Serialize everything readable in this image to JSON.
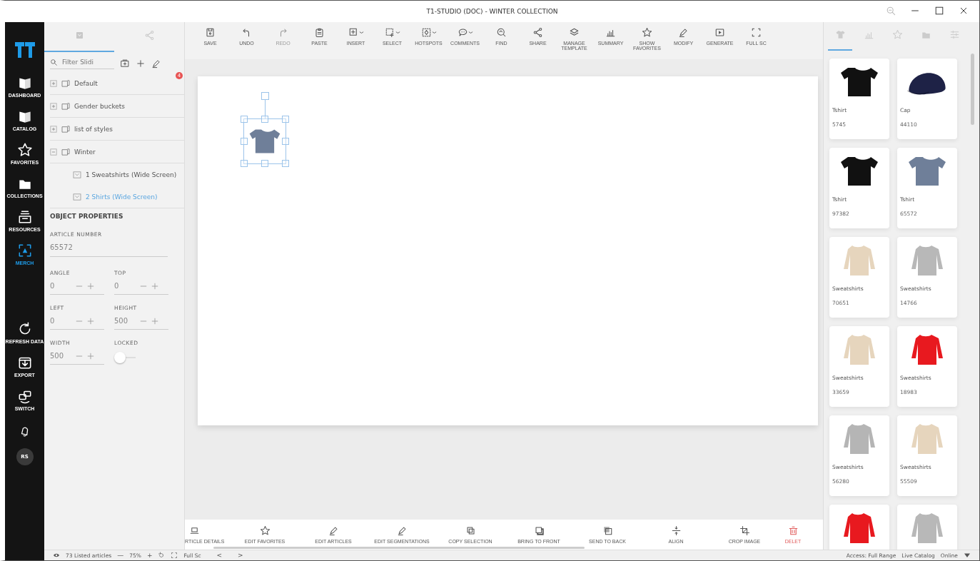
{
  "window": {
    "title": "T1-STUDIO (DOC) - WINTER COLLECTION"
  },
  "nav": {
    "items": [
      {
        "label": "DASHBOARD",
        "selected": false
      },
      {
        "label": "CATALOG",
        "selected": false
      },
      {
        "label": "FAVORITES",
        "selected": false
      },
      {
        "label": "COLLECTIONS",
        "selected": false
      },
      {
        "label": "RESOURCES",
        "selected": false
      },
      {
        "label": "MERCH",
        "selected": true
      },
      {
        "label": "REFRESH DATA",
        "selected": false
      },
      {
        "label": "EXPORT",
        "selected": false
      },
      {
        "label": "SWITCH",
        "selected": false
      }
    ],
    "avatar": "RS"
  },
  "left_panel": {
    "tabs": [
      {
        "selected": true
      },
      {
        "selected": false
      }
    ],
    "search": {
      "placeholder": "Filter Slidi"
    },
    "badge": "4",
    "tree": [
      {
        "label": "Default",
        "expanded": false
      },
      {
        "label": "Gender buckets",
        "expanded": false
      },
      {
        "label": "list of styles",
        "expanded": false
      },
      {
        "label": "Winter",
        "expanded": true,
        "children": [
          {
            "label": "1  Sweatshirts (Wide Screen)",
            "selected": false
          },
          {
            "label": "2  Shirts (Wide Screen)",
            "selected": true
          }
        ]
      }
    ],
    "properties": {
      "title": "OBJECT PROPERTIES",
      "article_label": "ARTICLE NUMBER",
      "article_value": "65572",
      "fields": [
        {
          "label": "ANGLE",
          "value": "0",
          "kind": "stepper"
        },
        {
          "label": "TOP",
          "value": "0",
          "kind": "stepper"
        },
        {
          "label": "LEFT",
          "value": "0",
          "kind": "stepper"
        },
        {
          "label": "HEIGHT",
          "value": "500",
          "kind": "stepper"
        },
        {
          "label": "WIDTH",
          "value": "500",
          "kind": "stepper"
        },
        {
          "label": "LOCKED",
          "kind": "toggle",
          "on": false
        }
      ]
    }
  },
  "toolbar": [
    {
      "label": "SAVE",
      "disabled": false,
      "dropdown": false
    },
    {
      "label": "UNDO",
      "disabled": false,
      "dropdown": false
    },
    {
      "label": "REDO",
      "disabled": true,
      "dropdown": false
    },
    {
      "label": "PASTE",
      "disabled": false,
      "dropdown": false
    },
    {
      "label": "INSERT",
      "disabled": false,
      "dropdown": true
    },
    {
      "label": "SELECT",
      "disabled": false,
      "dropdown": true
    },
    {
      "label": "HOTSPOTS",
      "disabled": false,
      "dropdown": true
    },
    {
      "label": "COMMENTS",
      "disabled": false,
      "dropdown": true
    },
    {
      "label": "FIND",
      "disabled": false,
      "dropdown": false
    },
    {
      "label": "SHARE",
      "disabled": false,
      "dropdown": false
    },
    {
      "label": "MANAGE TEMPLATE",
      "disabled": false,
      "dropdown": false
    },
    {
      "label": "SUMMARY",
      "disabled": false,
      "dropdown": false
    },
    {
      "label": "SHOW FAVORITES",
      "disabled": false,
      "dropdown": false
    },
    {
      "label": "MODIFY",
      "disabled": false,
      "dropdown": false
    },
    {
      "label": "GENERATE",
      "disabled": false,
      "dropdown": false
    },
    {
      "label": "FULL SC",
      "disabled": false,
      "dropdown": false
    }
  ],
  "actions": [
    {
      "label": "RTICLE DETAILS",
      "kind": "normal"
    },
    {
      "label": "EDIT FAVORITES",
      "kind": "normal"
    },
    {
      "label": "EDIT ARTICLES",
      "kind": "normal"
    },
    {
      "label": "EDIT SEGMENTATIONS",
      "kind": "normal"
    },
    {
      "label": "COPY SELECTION",
      "kind": "normal"
    },
    {
      "label": "BRING TO FRONT",
      "kind": "normal"
    },
    {
      "label": "SEND TO BACK",
      "kind": "normal"
    },
    {
      "label": "ALIGN",
      "kind": "normal"
    },
    {
      "label": "CROP IMAGE",
      "kind": "normal"
    },
    {
      "label": "DELET",
      "kind": "danger"
    }
  ],
  "status_bar": {
    "articles": "73 Listed articles",
    "zoom_out": "—",
    "zoom": "75%",
    "zoom_in": "+",
    "fullscreen": "Full Sc",
    "prev": "<",
    "next": ">",
    "access": "Access: Full Range",
    "catalog": "Live Catalog",
    "online": "Online"
  },
  "right_panel": {
    "tabs": [
      {
        "selected": true
      },
      {
        "selected": false
      },
      {
        "selected": false
      },
      {
        "selected": false
      },
      {
        "selected": false
      }
    ],
    "articles": [
      {
        "name": "Tshirt",
        "number": "5745",
        "kind": "tshirt",
        "color": "#111111"
      },
      {
        "name": "Cap",
        "number": "44110",
        "kind": "cap",
        "color": "#1e2246"
      },
      {
        "name": "Tshirt",
        "number": "97382",
        "kind": "tshirt",
        "color": "#111111"
      },
      {
        "name": "Tshirt",
        "number": "65572",
        "kind": "tshirt",
        "color": "#6f7f99"
      },
      {
        "name": "Sweatshirts",
        "number": "70651",
        "kind": "sweatshirt",
        "color": "#e6d5bd"
      },
      {
        "name": "Sweatshirts",
        "number": "14766",
        "kind": "sweatshirt",
        "color": "#b8b8b8"
      },
      {
        "name": "Sweatshirts",
        "number": "33659",
        "kind": "sweatshirt",
        "color": "#e6d5bd"
      },
      {
        "name": "Sweatshirts",
        "number": "18983",
        "kind": "sweatshirt",
        "color": "#e8191f"
      },
      {
        "name": "Sweatshirts",
        "number": "56280",
        "kind": "sweatshirt",
        "color": "#b5b5b5"
      },
      {
        "name": "Sweatshirts",
        "number": "55509",
        "kind": "sweatshirt",
        "color": "#e6d5bd"
      },
      {
        "kind": "sweatshirt",
        "color": "#e8191f"
      },
      {
        "kind": "sweatshirt",
        "color": "#b8b8b8"
      }
    ]
  },
  "canvas": {
    "objects": [
      {
        "kind": "tshirt",
        "color": "#6f7f99",
        "selected": true
      }
    ]
  }
}
